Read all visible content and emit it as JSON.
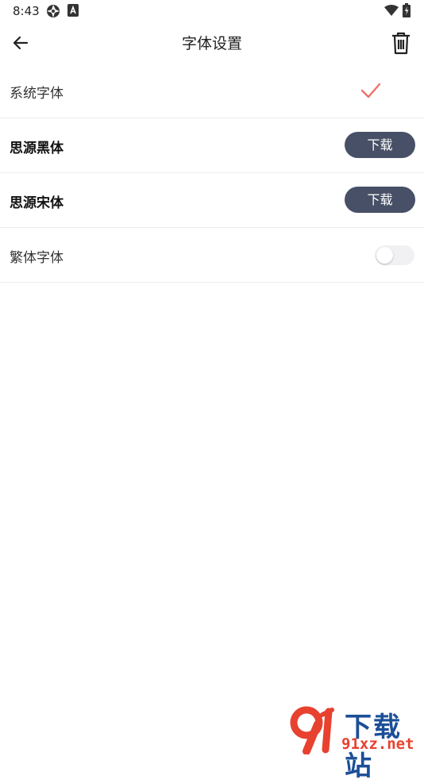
{
  "status_bar": {
    "time": "8:43",
    "icons": [
      "aperture-icon",
      "a-box-icon",
      "wifi-icon",
      "battery-icon"
    ]
  },
  "header": {
    "title": "字体设置",
    "back_icon": "arrow-left-icon",
    "trash_icon": "trash-icon"
  },
  "fonts": [
    {
      "label": "系统字体",
      "state": "selected"
    },
    {
      "label": "思源黑体",
      "action": "下载"
    },
    {
      "label": "思源宋体",
      "action": "下载"
    },
    {
      "label": "繁体字体",
      "toggle": "off"
    }
  ],
  "colors": {
    "accent_check": "#f0706a",
    "download_button": "#475066",
    "divider": "#ececec"
  },
  "watermark": {
    "top": "下载站",
    "bottom": "91xz.net"
  }
}
